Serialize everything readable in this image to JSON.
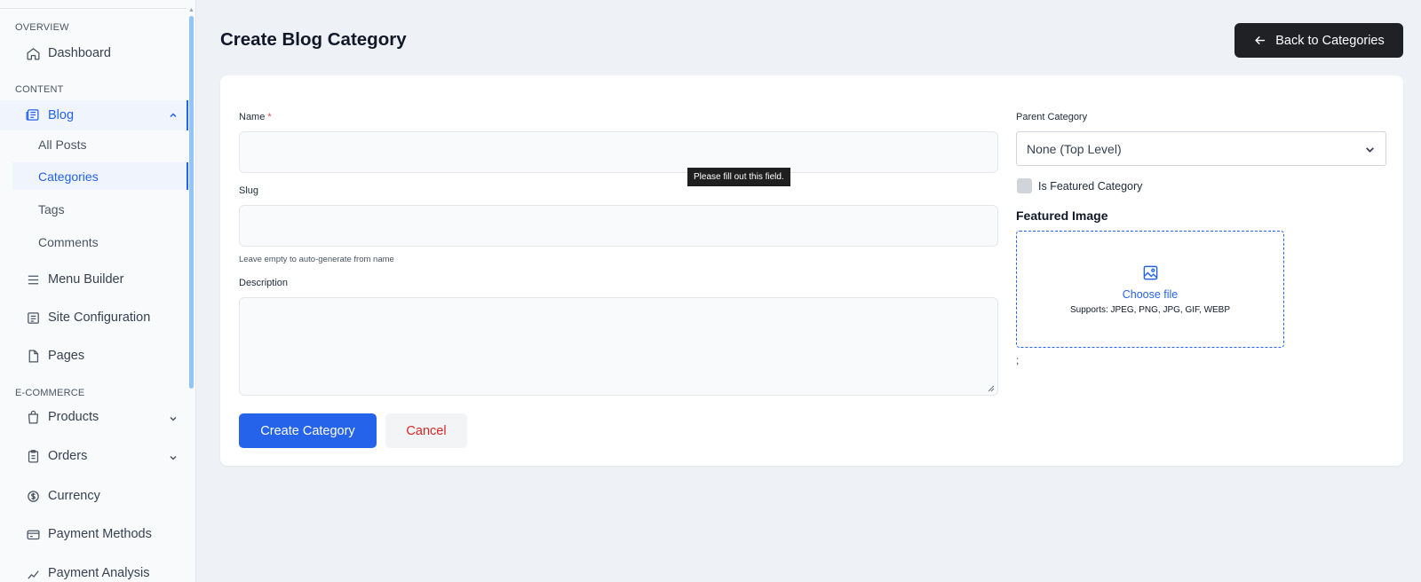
{
  "sidebar": {
    "sections": {
      "overview": "OVERVIEW",
      "content": "CONTENT",
      "ecommerce": "E-COMMERCE"
    },
    "items": {
      "dashboard": "Dashboard",
      "blog": "Blog",
      "menu_builder": "Menu Builder",
      "site_configuration": "Site Configuration",
      "pages": "Pages",
      "products": "Products",
      "orders": "Orders",
      "currency": "Currency",
      "payment_methods": "Payment Methods",
      "payment_analysis": "Payment Analysis"
    },
    "blog_sub": {
      "all_posts": "All Posts",
      "categories": "Categories",
      "tags": "Tags",
      "comments": "Comments"
    }
  },
  "header": {
    "title": "Create Blog Category",
    "back_label": "Back to Categories"
  },
  "form": {
    "name_label": "Name",
    "name_required": "*",
    "name_value": "",
    "validation_tooltip": "Please fill out this field.",
    "slug_label": "Slug",
    "slug_value": "",
    "slug_hint": "Leave empty to auto-generate from name",
    "description_label": "Description",
    "description_value": "",
    "parent_label": "Parent Category",
    "parent_selected": "None (Top Level)",
    "featured_checkbox_label": "Is Featured Category",
    "featured_image_title": "Featured Image",
    "choose_file": "Choose file",
    "supports": "Supports: JPEG, PNG, JPG, GIF, WEBP",
    "stray_text": ";",
    "submit_label": "Create Category",
    "cancel_label": "Cancel"
  },
  "colors": {
    "accent": "#2563eb",
    "dark_button": "#1f2125",
    "danger": "#dc2626",
    "background": "#eef1f5"
  }
}
